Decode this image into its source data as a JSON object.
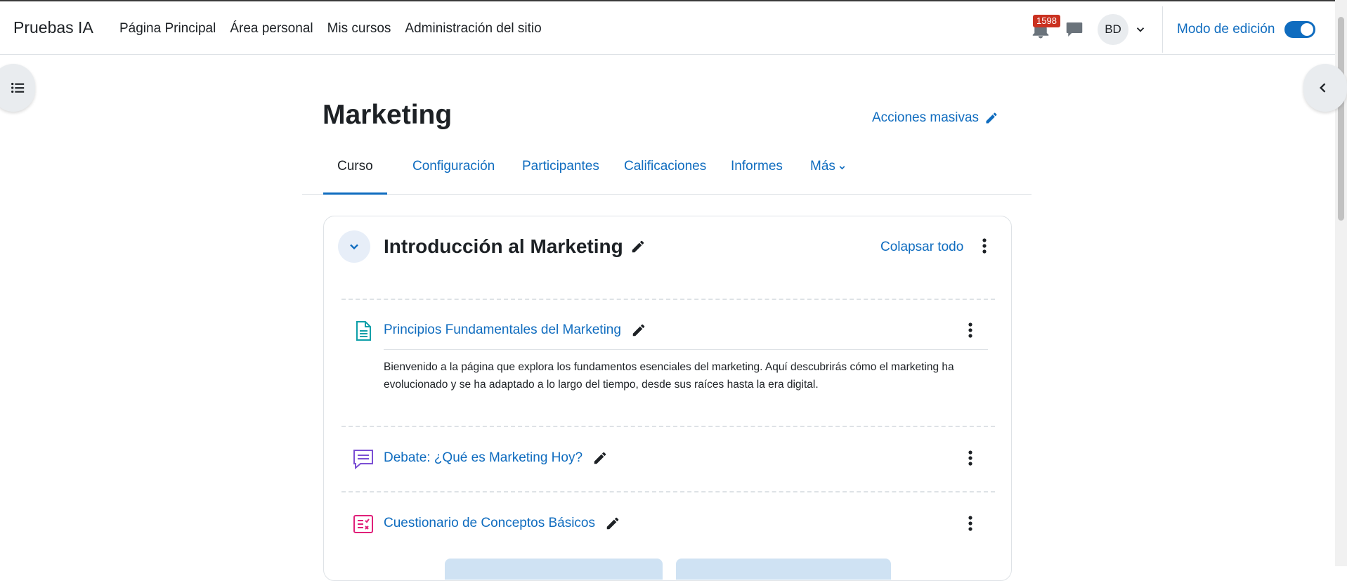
{
  "navbar": {
    "brand": "Pruebas IA",
    "links": [
      "Página Principal",
      "Área personal",
      "Mis cursos",
      "Administración del sitio"
    ],
    "notification_count": "1598",
    "avatar_initials": "BD",
    "edit_mode_label": "Modo de edición",
    "edit_mode_on": true
  },
  "course": {
    "title": "Marketing",
    "bulk_actions": "Acciones masivas",
    "tabs": [
      "Curso",
      "Configuración",
      "Participantes",
      "Calificaciones",
      "Informes",
      "Más"
    ],
    "active_tab": "Curso"
  },
  "section": {
    "title": "Introducción al Marketing",
    "collapse_all": "Colapsar todo",
    "activities": [
      {
        "type": "page",
        "icon": "page-icon",
        "name": "Principios Fundamentales del Marketing",
        "description": "Bienvenido a la página que explora los fundamentos esenciales del marketing. Aquí descubrirás cómo el marketing ha evolucionado y se ha adaptado a lo largo del tiempo, desde sus raíces hasta la era digital."
      },
      {
        "type": "forum",
        "icon": "forum-icon",
        "name": "Debate: ¿Qué es Marketing Hoy?"
      },
      {
        "type": "quiz",
        "icon": "quiz-icon",
        "name": "Cuestionario de Conceptos Básicos"
      }
    ]
  },
  "colors": {
    "link": "#0f6cbf",
    "badge": "#ca3120",
    "page_icon": "#0d9fa8",
    "forum_icon": "#7b4fd4",
    "quiz_icon": "#e0207a"
  }
}
